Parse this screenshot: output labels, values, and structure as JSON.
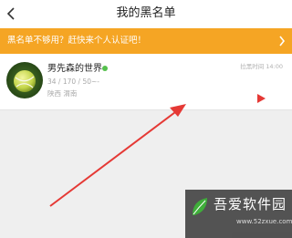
{
  "header": {
    "title": "我的黑名单"
  },
  "banner": {
    "text": "黑名单不够用？赶快来个人认证吧！"
  },
  "blacklist": [
    {
      "name": "男先森的世界",
      "stats": "34 / 170 / 50~-",
      "location": "陕西 渭南",
      "time": "拉黑时间 14:00"
    }
  ],
  "colors": {
    "banner": "#f5a524",
    "online": "#55c04c",
    "annotation_arrow": "#e53935"
  },
  "watermark": {
    "name": "吾爱软件园",
    "url": "www.52zxue.com"
  }
}
